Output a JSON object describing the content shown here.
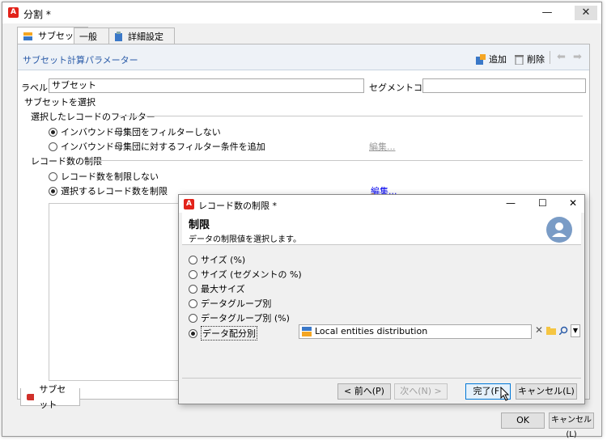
{
  "window": {
    "title": "分割 *",
    "controls": {
      "minimize": "—",
      "maximize": "☐",
      "close": "✕"
    }
  },
  "tabs": [
    {
      "label": "サブセット",
      "icon": "subset-icon"
    },
    {
      "label": "一般",
      "icon": ""
    },
    {
      "label": "詳細設定",
      "icon": "clipboard-icon"
    }
  ],
  "panel": {
    "header": "サブセット計算パラメーター",
    "toolbar": {
      "add_label": "追加",
      "delete_label": "削除"
    }
  },
  "form": {
    "label_caption": "ラベル:",
    "label_value": "サブセット",
    "segment_caption": "セグメントコード:",
    "segment_value": ""
  },
  "select_subset": {
    "title": "サブセットを選択",
    "filter_group": "選択したレコードのフィルター",
    "filter_options": [
      {
        "label": "インバウンド母集団をフィルターしない",
        "selected": true
      },
      {
        "label": "インバウンド母集団に対するフィルター条件を追加",
        "selected": false
      }
    ],
    "filter_edit_link": "編集...",
    "limit_group": "レコード数の制限",
    "limit_options": [
      {
        "label": "レコード数を制限しない",
        "selected": false
      },
      {
        "label": "選択するレコード数を制限",
        "selected": true
      }
    ],
    "limit_edit_link": "編集..."
  },
  "bottom_tab": {
    "label": "サブセット"
  },
  "footer": {
    "ok": "OK",
    "cancel": "キャンセル(L)"
  },
  "dialog": {
    "title": "レコード数の制限 *",
    "heading": "制限",
    "subheading": "データの制限値を選択します。",
    "options": [
      {
        "label": "サイズ (%)",
        "selected": false
      },
      {
        "label": "サイズ (セグメントの %)",
        "selected": false
      },
      {
        "label": "最大サイズ",
        "selected": false
      },
      {
        "label": "データグループ別",
        "selected": false
      },
      {
        "label": "データグループ別 (%)",
        "selected": false
      },
      {
        "label": "データ配分別",
        "selected": true
      }
    ],
    "distribution_value": "Local entities distribution",
    "buttons": {
      "prev": "< 前へ(P)",
      "next": "次へ(N) >",
      "finish": "完了(F)",
      "cancel": "キャンセル(L)"
    }
  },
  "colors": {
    "accent": "#2a5ba8",
    "arrow": "#f0a020",
    "brand": "#e2231a"
  }
}
